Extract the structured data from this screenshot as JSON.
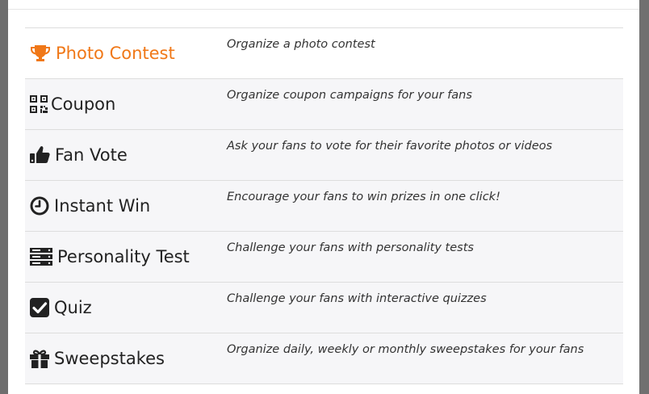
{
  "apps": [
    {
      "icon": "trophy-icon",
      "title": "Photo Contest",
      "description": "Organize a photo contest",
      "active": true
    },
    {
      "icon": "qr-code-icon",
      "title": "Coupon",
      "description": "Organize coupon campaigns for your fans",
      "active": false
    },
    {
      "icon": "thumbs-up-icon",
      "title": "Fan Vote",
      "description": "Ask your fans to vote for their favorite photos or videos",
      "active": false
    },
    {
      "icon": "clock-icon",
      "title": "Instant Win",
      "description": "Encourage your fans to win prizes in one click!",
      "active": false
    },
    {
      "icon": "server-icon",
      "title": "Personality Test",
      "description": "Challenge your fans with personality tests",
      "active": false
    },
    {
      "icon": "checkbox-icon",
      "title": "Quiz",
      "description": "Challenge your fans with interactive quizzes",
      "active": false
    },
    {
      "icon": "gift-icon",
      "title": "Sweepstakes",
      "description": "Organize daily, weekly or monthly sweepstakes for your fans",
      "active": false
    }
  ],
  "colors": {
    "accent": "#f07818",
    "text": "#222222",
    "row_alt": "#f6f6f8"
  }
}
